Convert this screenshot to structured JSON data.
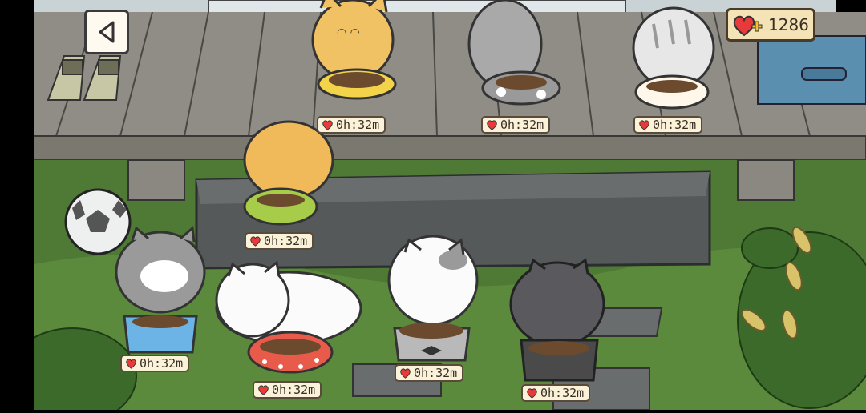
{
  "hud": {
    "back_label": "back",
    "hearts_count": "1286"
  },
  "colors": {
    "grass": "#4f7a35",
    "deck": "#8f8d86",
    "stone_step": "#56595a",
    "timer_bg": "#fbf3d9",
    "heart": "#e83a3a"
  },
  "bowls": [
    {
      "id": "yellow-deck",
      "timer": "0h:32m"
    },
    {
      "id": "polka-gray-deck",
      "timer": "0h:32m"
    },
    {
      "id": "white-deck",
      "timer": "0h:32m"
    },
    {
      "id": "green-step",
      "timer": "0h:32m"
    },
    {
      "id": "blue-square",
      "timer": "0h:32m"
    },
    {
      "id": "red-polka",
      "timer": "0h:32m"
    },
    {
      "id": "bow-bowl",
      "timer": "0h:32m"
    },
    {
      "id": "dark-square",
      "timer": "0h:32m"
    }
  ],
  "icons": [
    "back-arrow-icon",
    "heart-plus-icon",
    "heart-icon"
  ]
}
